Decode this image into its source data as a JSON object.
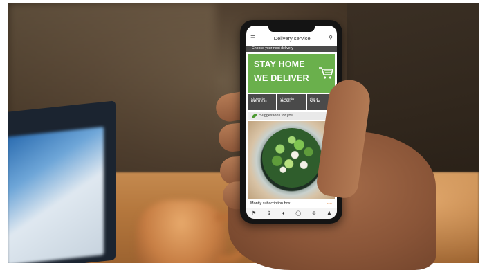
{
  "app": {
    "title": "Delivery service",
    "subtitle": "Choose your next delivery"
  },
  "banner": {
    "line1": "STAY HOME",
    "line2": "WE DELIVER",
    "icon": "shopping-cart-icon",
    "color": "#6ab04c"
  },
  "choices": [
    {
      "prefix": "Choose by",
      "label": "PRODUCT"
    },
    {
      "prefix": "Choose by",
      "label": "MENU"
    },
    {
      "prefix": "Plan &",
      "label": "SHOP"
    }
  ],
  "suggestions": {
    "label": "Suggestions for you",
    "icon": "leaf-icon"
  },
  "product": {
    "caption": "Montly subscription box",
    "price": "----"
  },
  "nav_icons": [
    "flag-icon",
    "fork-knife-icon",
    "drop-icon",
    "globe-icon",
    "add-icon",
    "user-icon"
  ],
  "header_icons": {
    "menu": "hamburger-icon",
    "search": "search-icon"
  }
}
